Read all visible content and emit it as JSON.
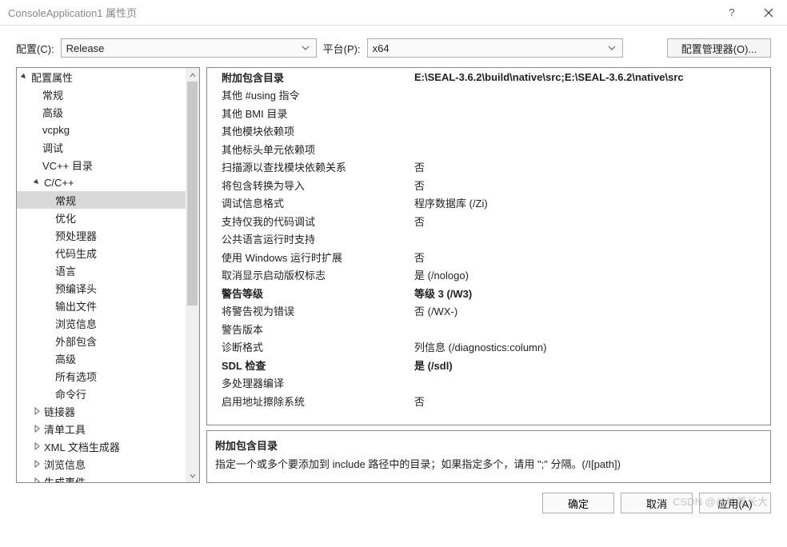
{
  "window": {
    "title": "ConsoleApplication1 属性页"
  },
  "toolbar": {
    "config_label": "配置(C):",
    "config_value": "Release",
    "platform_label": "平台(P):",
    "platform_value": "x64",
    "cfgmgr_label": "配置管理器(O)..."
  },
  "tree": {
    "root": "配置属性",
    "root_children": [
      "常规",
      "高级",
      "vcpkg",
      "调试",
      "VC++ 目录"
    ],
    "ccpp": "C/C++",
    "ccpp_children": [
      "常规",
      "优化",
      "预处理器",
      "代码生成",
      "语言",
      "预编译头",
      "输出文件",
      "浏览信息",
      "外部包含",
      "高级",
      "所有选项",
      "命令行"
    ],
    "after": [
      "链接器",
      "清单工具",
      "XML 文档生成器",
      "浏览信息",
      "生成事件"
    ],
    "selected": "常规"
  },
  "props": [
    {
      "name": "附加包含目录",
      "value": "E:\\SEAL-3.6.2\\build\\native\\src;E:\\SEAL-3.6.2\\native\\src",
      "bold": true
    },
    {
      "name": "其他 #using 指令",
      "value": ""
    },
    {
      "name": "其他 BMI 目录",
      "value": ""
    },
    {
      "name": "其他模块依赖项",
      "value": ""
    },
    {
      "name": "其他标头单元依赖项",
      "value": ""
    },
    {
      "name": "扫描源以查找模块依赖关系",
      "value": "否"
    },
    {
      "name": "将包含转换为导入",
      "value": "否"
    },
    {
      "name": "调试信息格式",
      "value": "程序数据库 (/Zi)"
    },
    {
      "name": "支持仅我的代码调试",
      "value": "否"
    },
    {
      "name": "公共语言运行时支持",
      "value": ""
    },
    {
      "name": "使用 Windows 运行时扩展",
      "value": "否"
    },
    {
      "name": "取消显示启动版权标志",
      "value": "是 (/nologo)"
    },
    {
      "name": "警告等级",
      "value": "等级 3 (/W3)",
      "bold": true
    },
    {
      "name": "将警告视为错误",
      "value": "否 (/WX-)"
    },
    {
      "name": "警告版本",
      "value": ""
    },
    {
      "name": "诊断格式",
      "value": "列信息 (/diagnostics:column)"
    },
    {
      "name": "SDL 检查",
      "value": "是 (/sdl)",
      "bold": true
    },
    {
      "name": "多处理器编译",
      "value": ""
    },
    {
      "name": "启用地址擦除系统",
      "value": "否"
    }
  ],
  "desc": {
    "name": "附加包含目录",
    "text": "指定一个或多个要添加到 include 路径中的目录；如果指定多个，请用 \";\" 分隔。(/I[path])"
  },
  "footer": {
    "ok": "确定",
    "cancel": "取消",
    "apply": "应用(A)"
  },
  "watermark": "CSDN @@忙着长大"
}
